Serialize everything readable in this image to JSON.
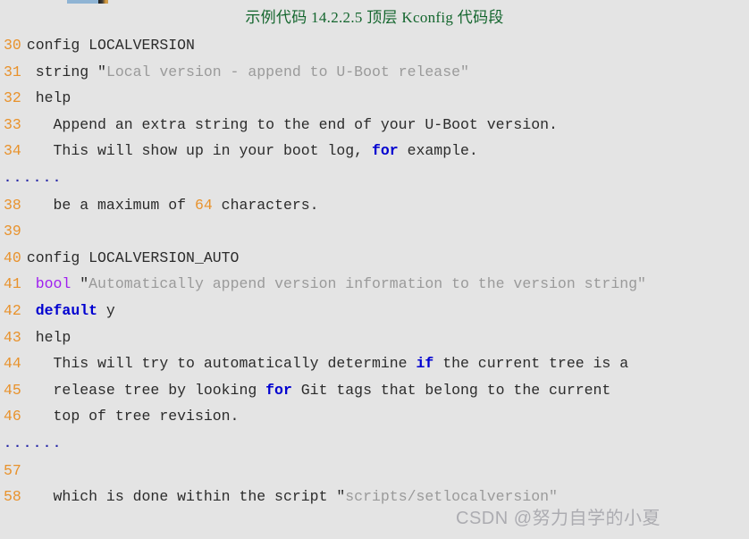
{
  "title": "示例代码 14.2.2.5 顶层 Kconfig 代码段",
  "watermark": "CSDN @努力自学的小夏",
  "colors": {
    "background": "#e4e4e4",
    "title": "#14662e",
    "line_number": "#e8922c",
    "code_text": "#2b2b2b",
    "keyword": "#0000d0",
    "type_keyword": "#a020f0",
    "string": "#9a9a9a",
    "number": "#e8922c",
    "ellipsis": "#2b2ba8",
    "watermark": "#787882"
  },
  "code": {
    "lines": [
      {
        "n": "30",
        "segments": [
          {
            "t": "config LOCALVERSION",
            "c": "plain"
          }
        ]
      },
      {
        "n": "31",
        "segments": [
          {
            "t": " string ",
            "c": "plain"
          },
          {
            "t": "\"",
            "c": "quote"
          },
          {
            "t": "Local version - append to U-Boot release",
            "c": "str"
          },
          {
            "t": "\"",
            "c": "str"
          }
        ]
      },
      {
        "n": "32",
        "segments": [
          {
            "t": " help",
            "c": "plain"
          }
        ]
      },
      {
        "n": "33",
        "segments": [
          {
            "t": "   Append an extra string to the end of your U-Boot version.",
            "c": "plain"
          }
        ]
      },
      {
        "n": "34",
        "segments": [
          {
            "t": "   This will show up in your boot log, ",
            "c": "plain"
          },
          {
            "t": "for",
            "c": "kw"
          },
          {
            "t": " example.",
            "c": "plain"
          }
        ]
      },
      {
        "n": "",
        "segments": [
          {
            "t": "......",
            "c": "ellipsis"
          }
        ]
      },
      {
        "n": "38",
        "segments": [
          {
            "t": "   be a maximum of ",
            "c": "plain"
          },
          {
            "t": "64",
            "c": "num"
          },
          {
            "t": " characters.",
            "c": "plain"
          }
        ]
      },
      {
        "n": "39",
        "segments": [
          {
            "t": "",
            "c": "plain"
          }
        ]
      },
      {
        "n": "40",
        "segments": [
          {
            "t": "config LOCALVERSION_AUTO",
            "c": "plain"
          }
        ]
      },
      {
        "n": "41",
        "segments": [
          {
            "t": " ",
            "c": "plain"
          },
          {
            "t": "bool",
            "c": "type"
          },
          {
            "t": " ",
            "c": "plain"
          },
          {
            "t": "\"",
            "c": "quote"
          },
          {
            "t": "Automatically append version information to the version string",
            "c": "str"
          },
          {
            "t": "\"",
            "c": "str"
          }
        ]
      },
      {
        "n": "42",
        "segments": [
          {
            "t": " ",
            "c": "plain"
          },
          {
            "t": "default",
            "c": "kw"
          },
          {
            "t": " y",
            "c": "plain"
          }
        ]
      },
      {
        "n": "43",
        "segments": [
          {
            "t": " help",
            "c": "plain"
          }
        ]
      },
      {
        "n": "44",
        "segments": [
          {
            "t": "   This will try to automatically determine ",
            "c": "plain"
          },
          {
            "t": "if",
            "c": "kw"
          },
          {
            "t": " the current tree is a",
            "c": "plain"
          }
        ]
      },
      {
        "n": "45",
        "segments": [
          {
            "t": "   release tree by looking ",
            "c": "plain"
          },
          {
            "t": "for",
            "c": "kw"
          },
          {
            "t": " Git tags that belong to the current",
            "c": "plain"
          }
        ]
      },
      {
        "n": "46",
        "segments": [
          {
            "t": "   top of tree revision.",
            "c": "plain"
          }
        ]
      },
      {
        "n": "",
        "segments": [
          {
            "t": "......",
            "c": "ellipsis"
          }
        ]
      },
      {
        "n": "57",
        "segments": [
          {
            "t": "",
            "c": "plain"
          }
        ]
      },
      {
        "n": "58",
        "segments": [
          {
            "t": "   which is done within the script ",
            "c": "plain"
          },
          {
            "t": "\"",
            "c": "quote"
          },
          {
            "t": "scripts/setlocalversion\"",
            "c": "str"
          }
        ]
      }
    ]
  }
}
